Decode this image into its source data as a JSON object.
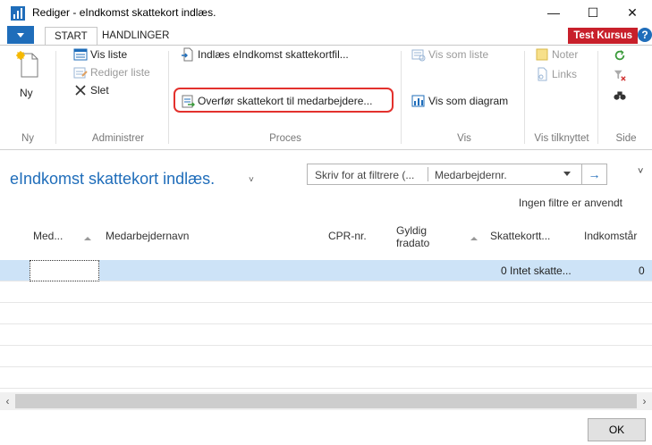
{
  "window": {
    "title": "Rediger - eIndkomst skattekort indlæs.",
    "minimize": "—",
    "maximize": "☐",
    "close": "✕"
  },
  "tabs": {
    "start": "START",
    "actions": "HANDLINGER",
    "company": "Test Kursus",
    "help": "?"
  },
  "ribbon": {
    "new_label": "Ny",
    "groups": {
      "new": "Ny",
      "manage": "Administrer",
      "process": "Proces",
      "view": "Vis",
      "show_attached": "Vis tilknyttet",
      "page": "Side"
    },
    "manage": {
      "view_list": "Vis liste",
      "edit_list": "Rediger liste",
      "delete": "Slet"
    },
    "process": {
      "import": "Indlæs eIndkomst skattekortfil...",
      "transfer": "Overfør skattekort til medarbejdere..."
    },
    "view": {
      "as_list": "Vis som liste",
      "as_chart": "Vis som diagram"
    },
    "attached": {
      "notes": "Noter",
      "links": "Links"
    }
  },
  "page": {
    "title": "eIndkomst skattekort indlæs.",
    "title_chevron": "˅",
    "filter_placeholder": "Skriv for at filtrere (...",
    "filter_field": "Medarbejdernr.",
    "go_arrow": "→",
    "collapse": "˅",
    "no_filters": "Ingen filtre er anvendt"
  },
  "table": {
    "columns": [
      "Med...",
      "Medarbejdernavn",
      "CPR-nr.",
      "Gyldig",
      "fradato",
      "Skattekortt...",
      "Indkomstår"
    ],
    "row": {
      "tax_card": "0 Intet skatte...",
      "income_year": "0"
    }
  },
  "scroll": {
    "left": "‹",
    "right": "›"
  },
  "footer": {
    "ok": "OK"
  },
  "colors": {
    "accent": "#1f6dba",
    "company": "#c8202b",
    "highlight": "#e3312d",
    "selected_row": "#cde3f7"
  }
}
